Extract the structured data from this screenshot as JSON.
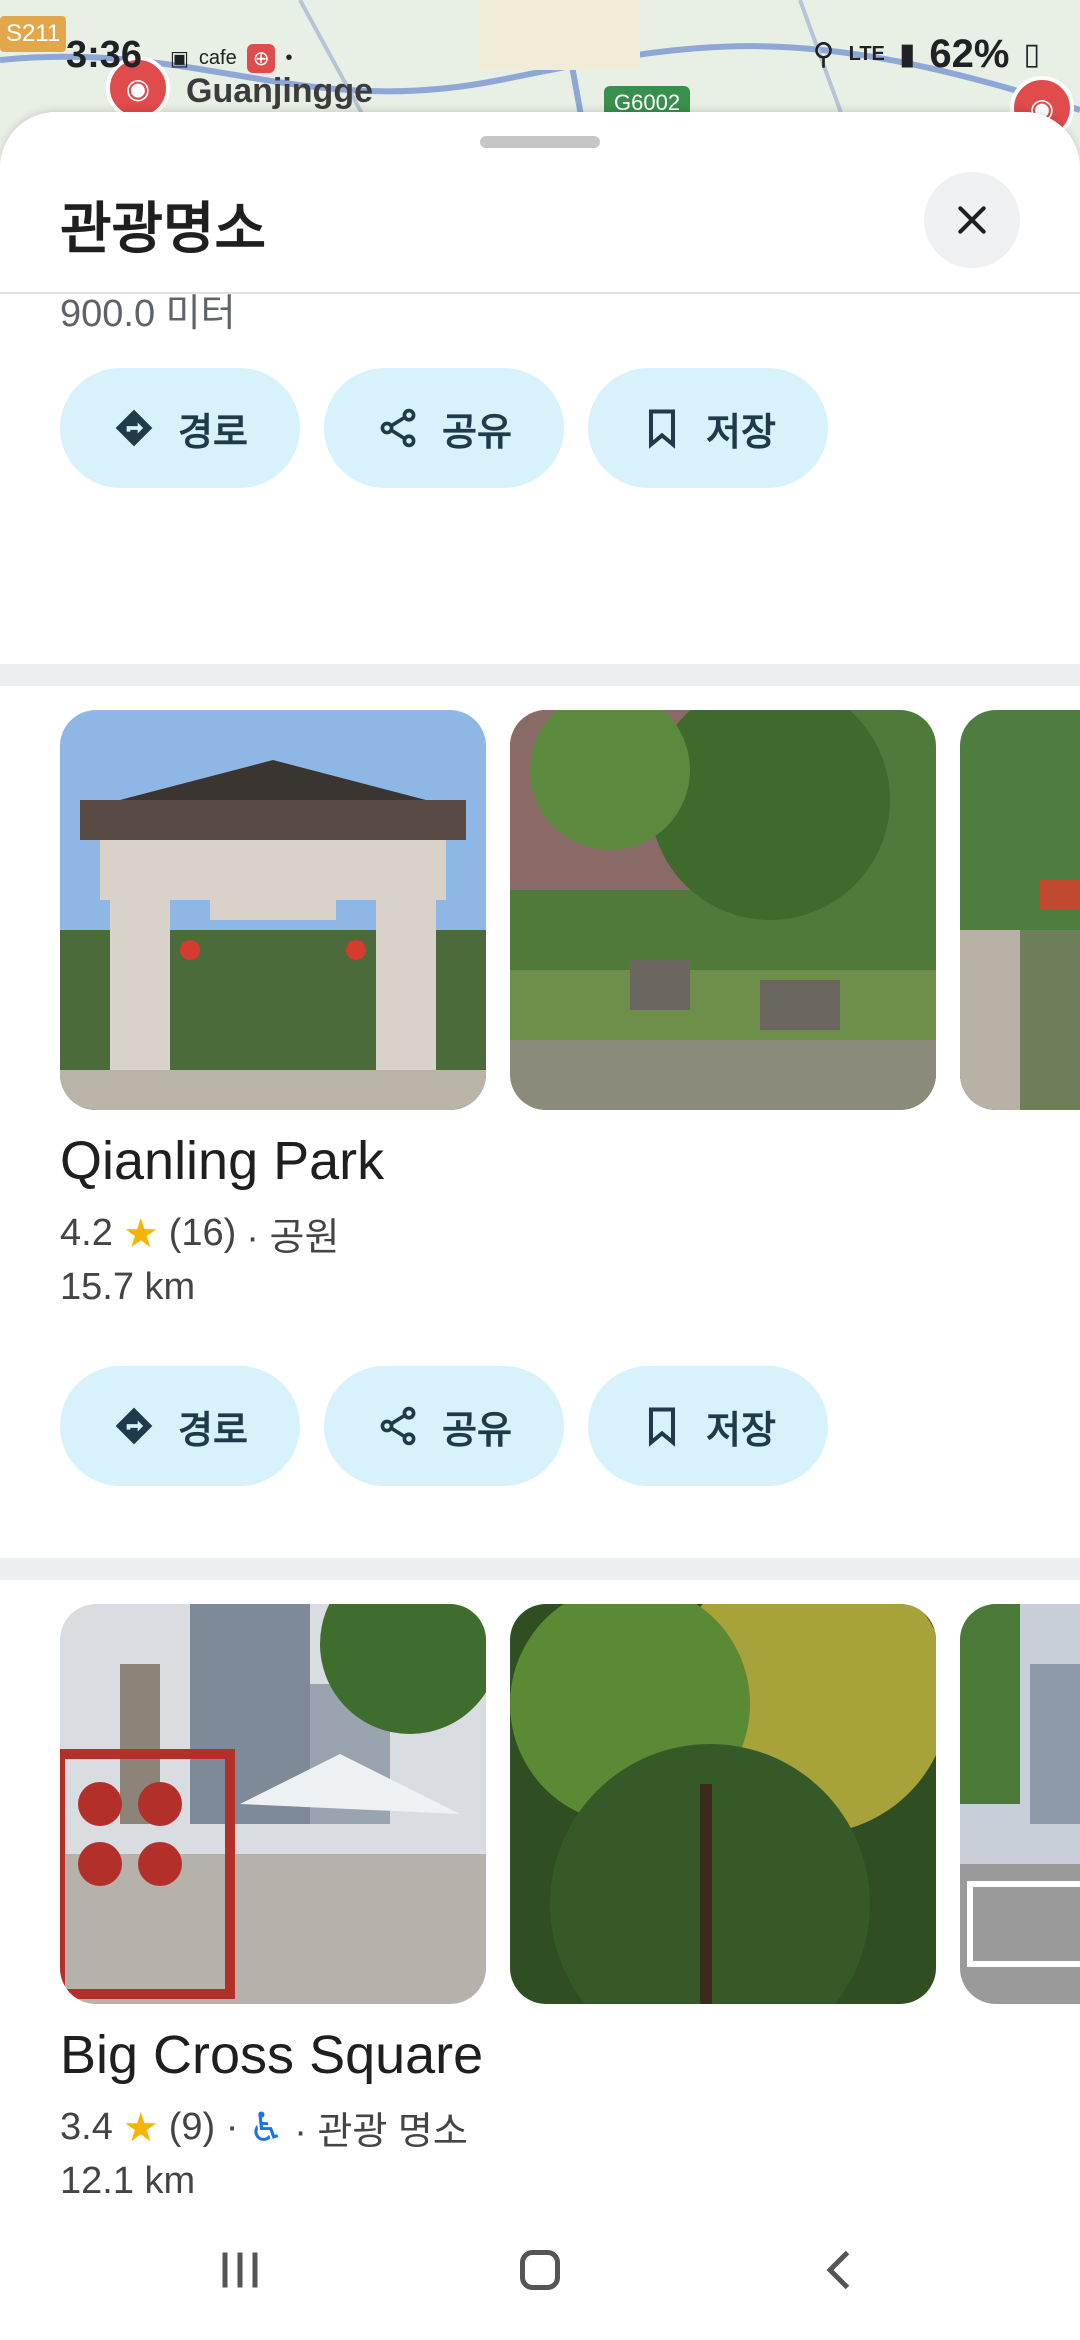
{
  "status_bar": {
    "time": "3:36",
    "battery": "62%",
    "network": "LTE"
  },
  "map": {
    "place_label": "Guanjingge",
    "road_badge_1": "S211",
    "road_badge_2": "G6002",
    "cafe_label": "cafe"
  },
  "sheet": {
    "title": "관광명소",
    "top_partial_text": "900.0 미터"
  },
  "actions": {
    "directions": "경로",
    "share": "공유",
    "save": "저장"
  },
  "places": [
    {
      "name": "Qianling Park",
      "rating": "4.2",
      "reviews": "(16)",
      "category": "· 공원",
      "distance": "15.7 km"
    },
    {
      "name": "Big Cross Square",
      "rating": "3.4",
      "reviews": "(9) ·",
      "category": "· 관광 명소",
      "distance": "12.1 km"
    }
  ],
  "icons": {
    "close": "close-icon",
    "directions": "directions-icon",
    "share": "share-icon",
    "save": "bookmark-icon",
    "star": "star-icon",
    "accessible": "wheelchair-icon"
  },
  "colors": {
    "chip_bg": "#d7f2fb",
    "star": "#f4b400",
    "accessible": "#1a73e8"
  }
}
